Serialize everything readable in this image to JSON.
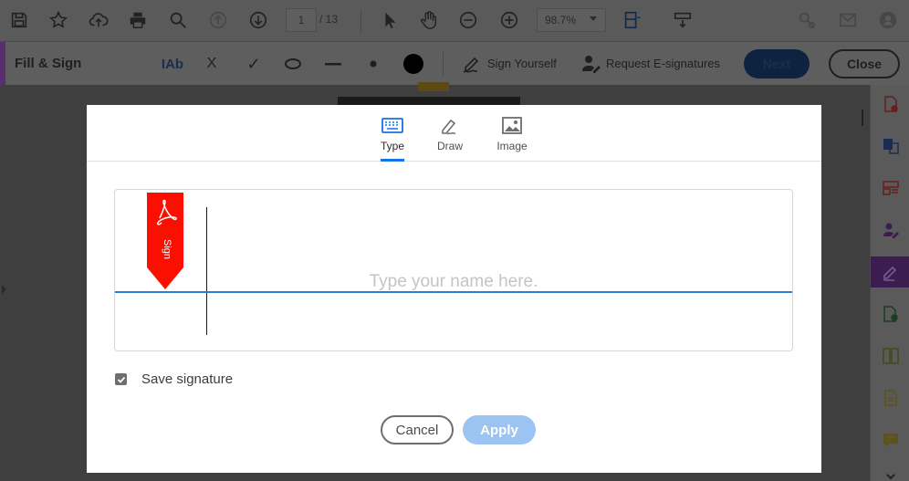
{
  "toolbar": {
    "page_current": "1",
    "page_total": "/ 13",
    "zoom": "98.7%",
    "icons": [
      "save-icon",
      "star-icon",
      "upload-icon",
      "print-icon",
      "search-icon",
      "page-up-icon",
      "page-down-icon",
      "select-arrow-icon",
      "hand-icon",
      "zoom-out-icon",
      "zoom-in-icon",
      "page-fit-icon",
      "scroll-mode-icon",
      "share-icon",
      "mail-icon",
      "account-icon"
    ]
  },
  "fill_sign": {
    "title": "Fill & Sign",
    "text_tool": "IAb",
    "cross": "X",
    "check": "✓",
    "sign_yourself": "Sign Yourself",
    "request_esign": "Request E-signatures",
    "next": "Next",
    "close": "Close"
  },
  "dialog": {
    "tabs": [
      {
        "label": "Type",
        "icon": "keyboard-icon",
        "active": true
      },
      {
        "label": "Draw",
        "icon": "pen-icon",
        "active": false
      },
      {
        "label": "Image",
        "icon": "image-icon",
        "active": false
      }
    ],
    "placeholder": "Type your name here.",
    "sign_flag_text": "Sign",
    "save_signature": "Save signature",
    "save_checked": true,
    "cancel": "Cancel",
    "apply": "Apply"
  },
  "colors": {
    "accent_blue": "#1473e6",
    "apply_disabled": "#9bc4f3",
    "flag_red": "#fa0f00",
    "active_sidebar": "#3b1d4f"
  }
}
